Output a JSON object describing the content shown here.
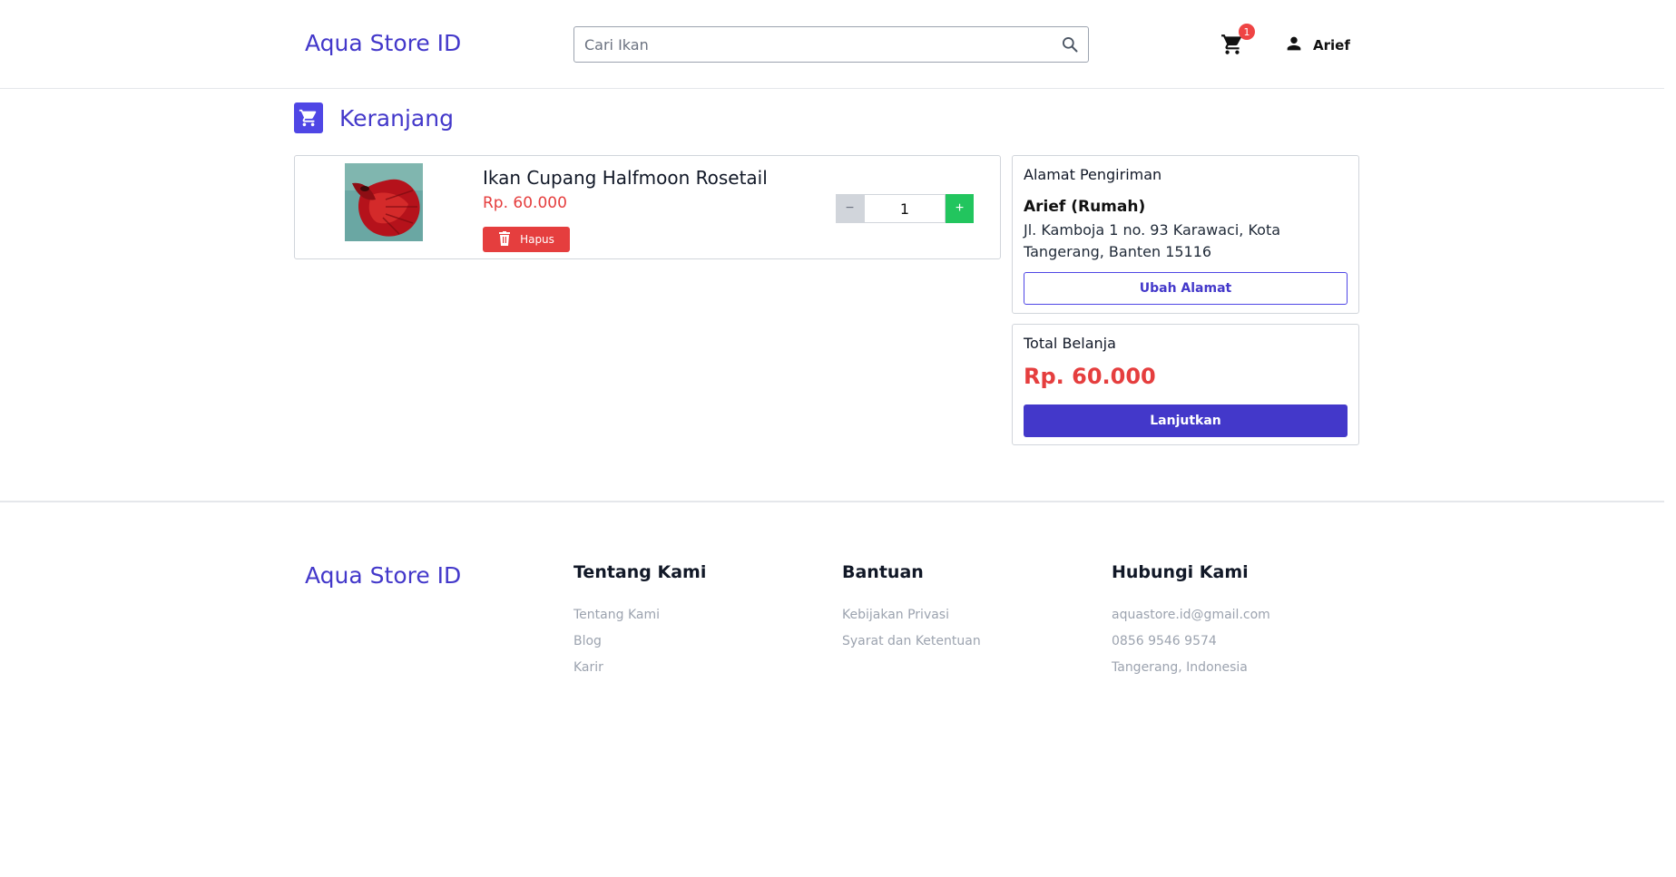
{
  "header": {
    "brand": "Aqua Store ID",
    "search_placeholder": "Cari Ikan",
    "cart_count": "1",
    "user_name": "Arief"
  },
  "page": {
    "title": "Keranjang"
  },
  "cart": {
    "items": [
      {
        "name": "Ikan Cupang Halfmoon Rosetail",
        "price": "Rp. 60.000",
        "remove_label": "Hapus",
        "quantity": "1",
        "decrement_label": "−",
        "increment_label": "+"
      }
    ]
  },
  "address": {
    "title": "Alamat Pengiriman",
    "name": "Arief (Rumah)",
    "text": "Jl. Kamboja 1 no. 93 Karawaci, Kota Tangerang, Banten 15116",
    "change_label": "Ubah Alamat"
  },
  "summary": {
    "title": "Total Belanja",
    "total": "Rp. 60.000",
    "continue_label": "Lanjutkan"
  },
  "footer": {
    "brand": "Aqua Store ID",
    "columns": [
      {
        "title": "Tentang Kami",
        "links": [
          "Tentang Kami",
          "Blog",
          "Karir"
        ]
      },
      {
        "title": "Bantuan",
        "links": [
          "Kebijakan Privasi",
          "Syarat dan Ketentuan"
        ]
      },
      {
        "title": "Hubungi Kami",
        "links": [
          "aquastore.id@gmail.com",
          "0856 9546 9574",
          "Tangerang, Indonesia"
        ]
      }
    ]
  },
  "colors": {
    "primary": "#4338ca",
    "price_red": "#e53e3e",
    "plus_green": "#22c55e",
    "badge_red": "#ef4444"
  }
}
